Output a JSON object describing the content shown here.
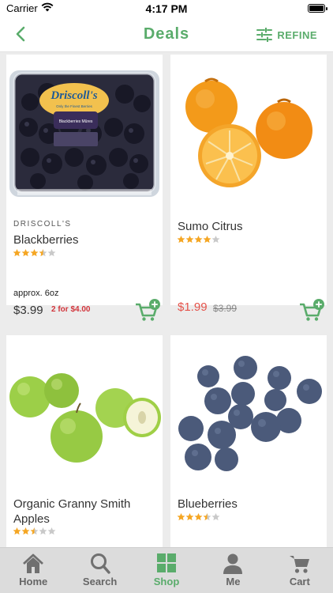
{
  "status_bar": {
    "carrier": "Carrier",
    "time": "4:17 PM"
  },
  "header": {
    "title": "Deals",
    "refine_label": "REFINE"
  },
  "products": [
    {
      "brand": "DRISCOLL'S",
      "name": "Blackberries",
      "rating": 3.5,
      "size": "approx. 6oz",
      "price": "$3.99",
      "promo": "2 for $4.00"
    },
    {
      "brand": "",
      "name": "Sumo Citrus",
      "rating": 4,
      "price": "$1.99",
      "was_price": "$3.99"
    },
    {
      "brand": "",
      "name": "Organic Granny Smith Apples",
      "rating": 2.5
    },
    {
      "brand": "",
      "name": "Blueberries",
      "rating": 3.5
    }
  ],
  "product_images": {
    "blackberries_logo": "Driscoll's",
    "blackberries_tagline": "Only the Finest Berries",
    "blackberries_label": "Blackberries Mûres"
  },
  "tabs": [
    {
      "label": "Home",
      "icon": "home-icon"
    },
    {
      "label": "Search",
      "icon": "search-icon"
    },
    {
      "label": "Shop",
      "icon": "grid-icon",
      "active": true
    },
    {
      "label": "Me",
      "icon": "person-icon"
    },
    {
      "label": "Cart",
      "icon": "cart-icon"
    }
  ],
  "colors": {
    "accent": "#5aac6b",
    "sale": "#e5534b",
    "promo": "#d2353c",
    "star": "#f5a623"
  }
}
